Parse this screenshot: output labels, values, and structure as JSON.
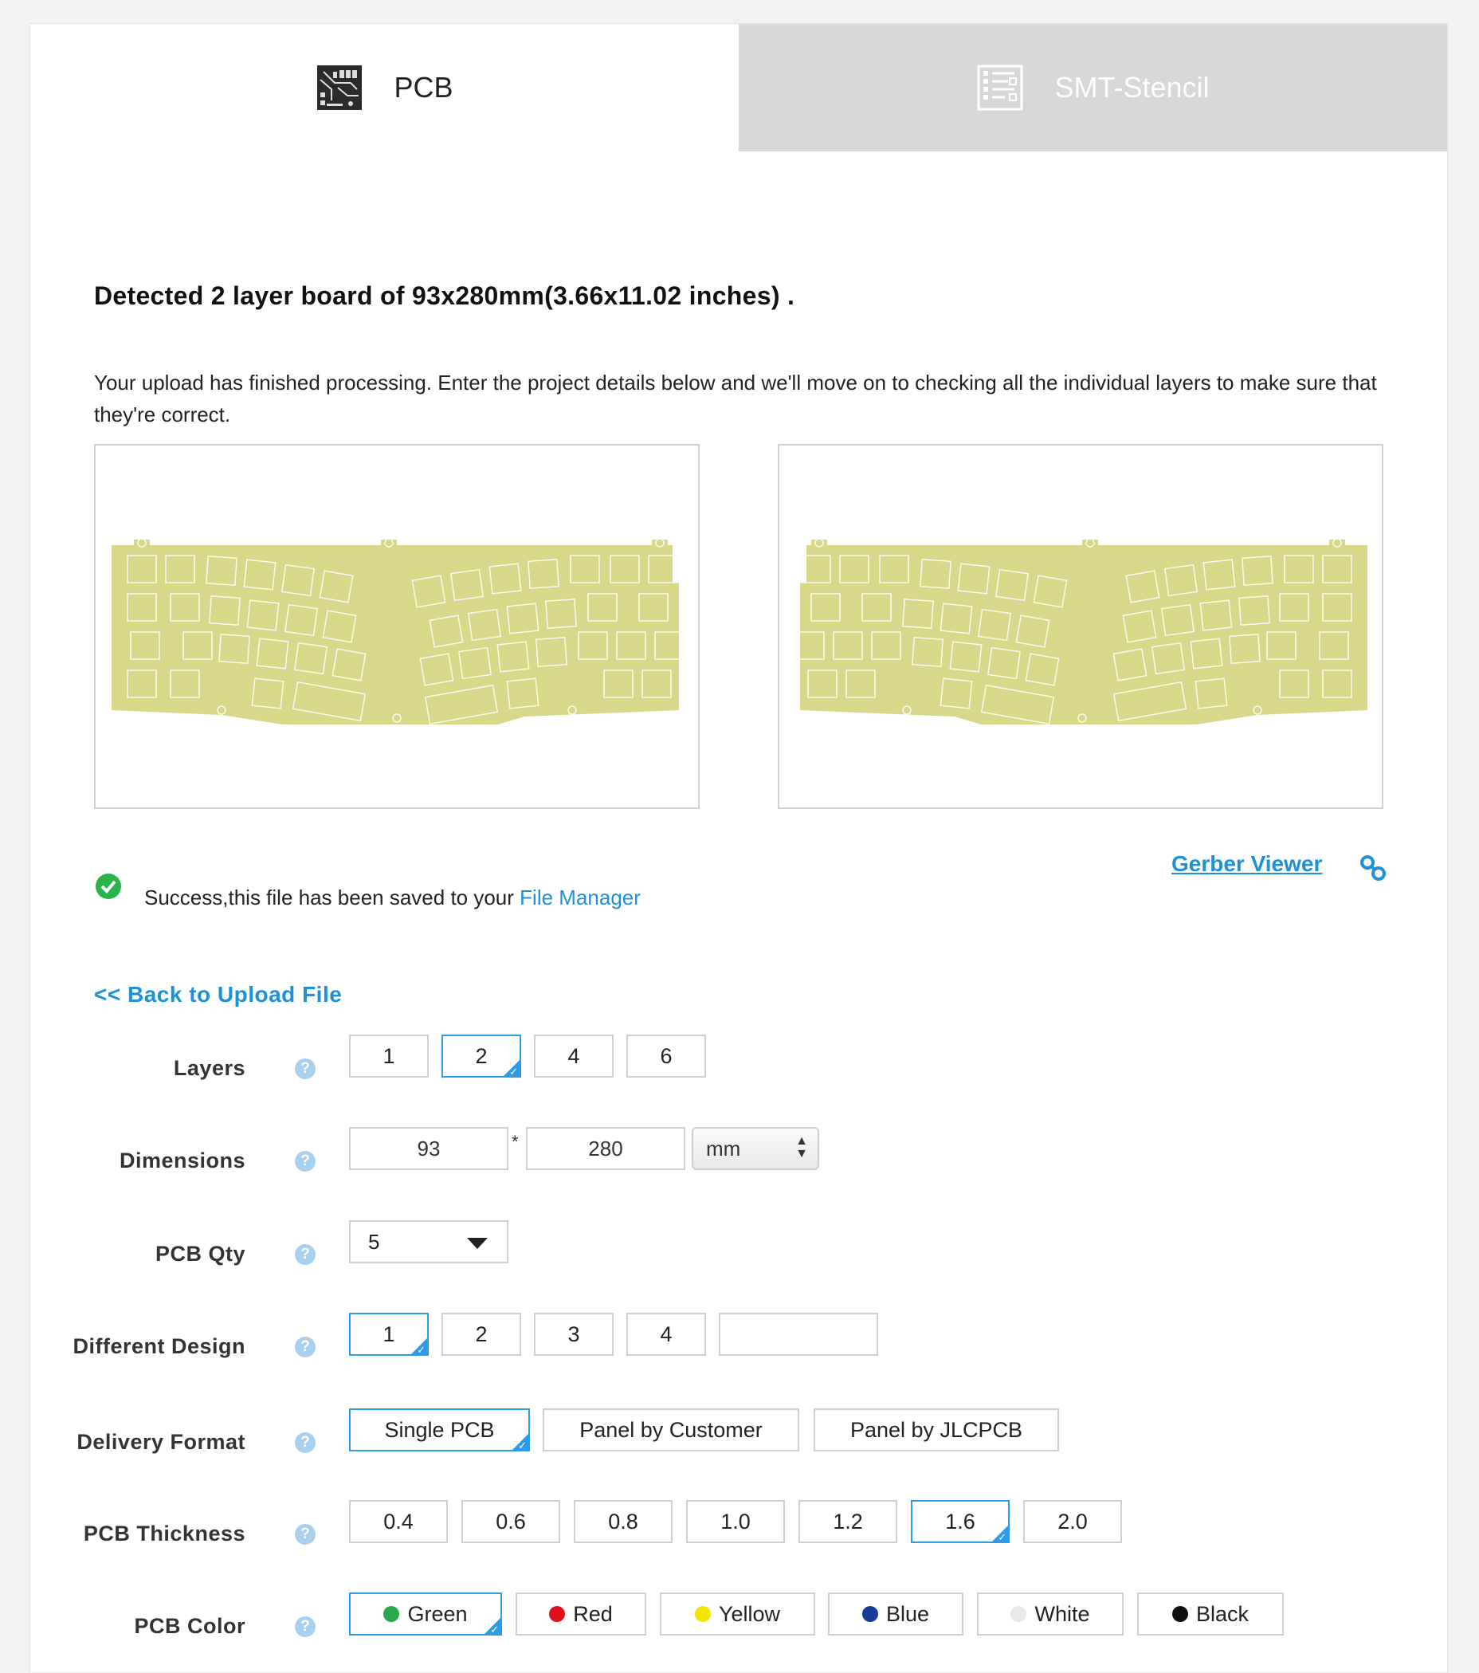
{
  "tabs": [
    {
      "label": "PCB",
      "icon": "pcb-icon",
      "active": true
    },
    {
      "label": "SMT-Stencil",
      "icon": "stencil-icon",
      "active": false
    }
  ],
  "heading": "Detected 2 layer board of 93x280mm(3.66x11.02 inches) .",
  "intro": "Your upload has finished processing. Enter the project details below and we'll move on to checking all the individual layers to make sure that they're correct.",
  "gerber_viewer": {
    "label": "Gerber Viewer",
    "icon": "link-icon"
  },
  "success": {
    "text": "Success,this file has been saved to your ",
    "link": "File Manager",
    "icon": "check-circle-icon"
  },
  "back_link": "<< Back to Upload File",
  "form": {
    "layers": {
      "label": "Layers",
      "options": [
        "1",
        "2",
        "4",
        "6"
      ],
      "selected": "2"
    },
    "dimensions": {
      "label": "Dimensions",
      "width": "93",
      "height": "280",
      "separator": "*",
      "unit": "mm"
    },
    "qty": {
      "label": "PCB Qty",
      "value": "5"
    },
    "design": {
      "label": "Different Design",
      "options": [
        "1",
        "2",
        "3",
        "4"
      ],
      "selected": "1",
      "custom": ""
    },
    "delivery": {
      "label": "Delivery Format",
      "options": [
        "Single PCB",
        "Panel by Customer",
        "Panel by JLCPCB"
      ],
      "selected": "Single PCB"
    },
    "thickness": {
      "label": "PCB Thickness",
      "options": [
        "0.4",
        "0.6",
        "0.8",
        "1.0",
        "1.2",
        "1.6",
        "2.0"
      ],
      "selected": "1.6"
    },
    "color": {
      "label": "PCB Color",
      "options": [
        {
          "name": "Green",
          "hex": "#2aa84a"
        },
        {
          "name": "Red",
          "hex": "#e0101a"
        },
        {
          "name": "Yellow",
          "hex": "#f2e600"
        },
        {
          "name": "Blue",
          "hex": "#163e98"
        },
        {
          "name": "White",
          "hex": "#e8e8e8"
        },
        {
          "name": "Black",
          "hex": "#111111"
        }
      ],
      "selected": "Green"
    }
  },
  "colors": {
    "accent": "#2e9be8",
    "link": "#1e90d8",
    "board": "#d8d78a",
    "success": "#2ab34a"
  }
}
